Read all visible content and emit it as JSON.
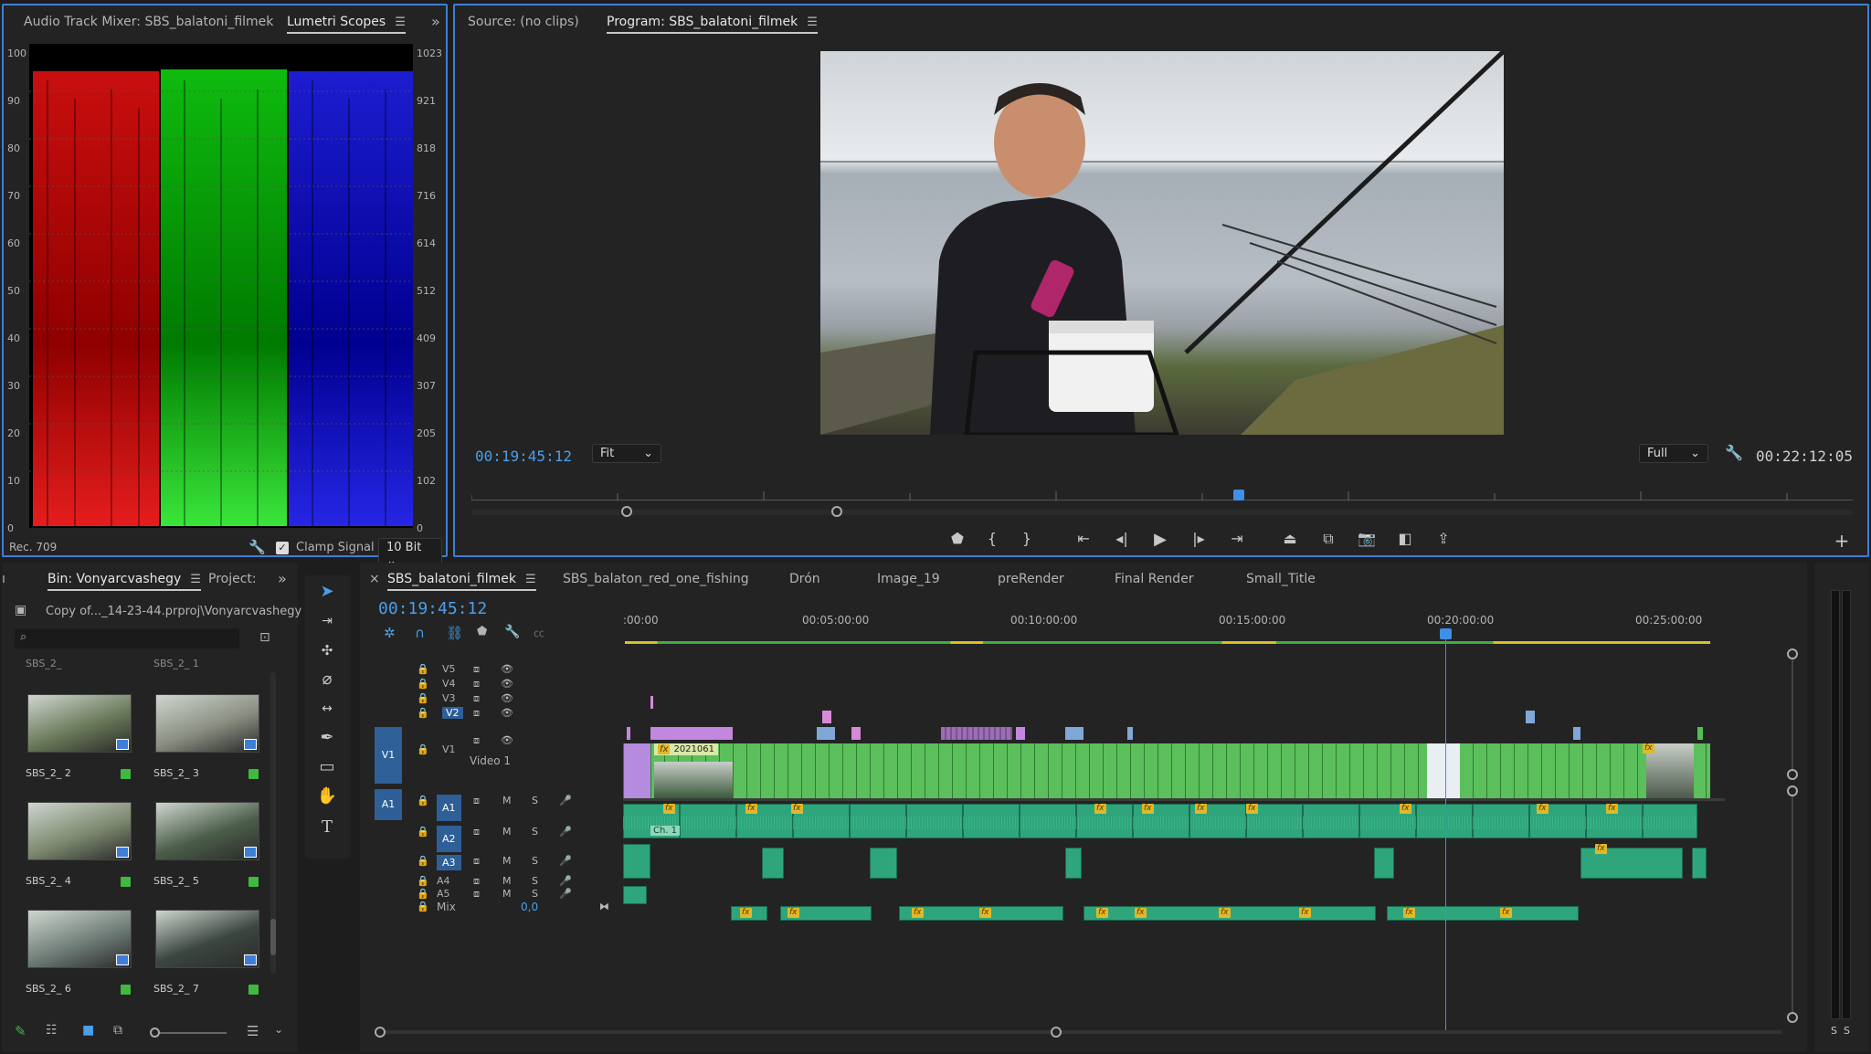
{
  "scopes_panel": {
    "tab_mixer": "Audio Track Mixer: SBS_balatoni_filmek",
    "tab_lumetri": "Lumetri Scopes",
    "y_left": [
      "100",
      "90",
      "80",
      "70",
      "60",
      "50",
      "40",
      "30",
      "20",
      "10",
      "0"
    ],
    "y_right": [
      "1023",
      "921",
      "818",
      "716",
      "614",
      "512",
      "409",
      "307",
      "205",
      "102",
      "0"
    ],
    "colorspace": "Rec. 709",
    "clamp_label": "Clamp Signal",
    "bitdepth": "10 Bit"
  },
  "monitor": {
    "source_tab": "Source: (no clips)",
    "program_tab": "Program: SBS_balatoni_filmek",
    "current_tc": "00:19:45:12",
    "fit": "Fit",
    "quality": "Full",
    "duration_tc": "00:22:12:05"
  },
  "project_panel": {
    "bin_tab": "Bin: Vonyarcvashegy",
    "project_tab": "Project:",
    "path": "Copy of..._14-23-44.prproj\\Vonyarcvashegy",
    "search_placeholder": "",
    "clips": [
      {
        "name": "SBS_2_ 2"
      },
      {
        "name": "SBS_2_ 3"
      },
      {
        "name": "SBS_2_ 4"
      },
      {
        "name": "SBS_2_ 5"
      },
      {
        "name": "SBS_2_ 6"
      },
      {
        "name": "SBS_2_ 7"
      }
    ],
    "partial_top": [
      "SBS_2_",
      "SBS_2_ 1"
    ]
  },
  "timeline": {
    "tabs": [
      "SBS_balatoni_filmek",
      "SBS_balaton_red_one_fishing",
      "Drón",
      "Image_19",
      "preRender",
      "Final Render",
      "Small_Title"
    ],
    "current_tc": "00:19:45:12",
    "ruler": [
      ":00:00",
      "00:05:00:00",
      "00:10:00:00",
      "00:15:00:00",
      "00:20:00:00",
      "00:25:00:00"
    ],
    "video_tracks": [
      "V5",
      "V4",
      "V3",
      "V2",
      "V1"
    ],
    "v1_name": "Video 1",
    "audio_tracks": [
      "A1",
      "A2",
      "A3",
      "A4",
      "A5"
    ],
    "mix_label": "Mix",
    "mix_value": "0,0",
    "clip_label": "2021061",
    "ch_label": "Ch. 1",
    "m_label": "M",
    "s_label": "S",
    "src_v1": "V1",
    "src_a1": "A1",
    "fx_label": "fx"
  },
  "meter": {
    "labels": [
      "S",
      "S"
    ]
  },
  "colors": {
    "accent": "#4a9fea",
    "clip_video": "#5bbf5b",
    "clip_audio": "#2fa57c",
    "fx": "#e0b829"
  }
}
